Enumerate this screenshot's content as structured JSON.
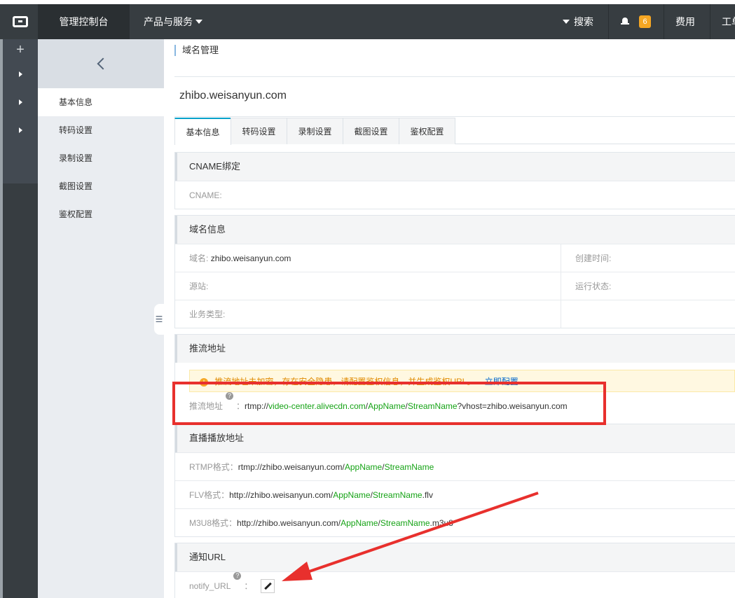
{
  "topbar": {
    "console": "管理控制台",
    "products": "产品与服务",
    "search": "搜索",
    "notifications": "6",
    "fee": "费用",
    "ticket": "工单"
  },
  "rail": {
    "plus": "+"
  },
  "sidebar": {
    "items": [
      {
        "label": "基本信息"
      },
      {
        "label": "转码设置"
      },
      {
        "label": "录制设置"
      },
      {
        "label": "截图设置"
      },
      {
        "label": "鉴权配置"
      }
    ]
  },
  "main": {
    "breadcrumb": "域名管理",
    "domain": "zhibo.weisanyun.com",
    "tabs": [
      {
        "label": "基本信息"
      },
      {
        "label": "转码设置"
      },
      {
        "label": "录制设置"
      },
      {
        "label": "截图设置"
      },
      {
        "label": "鉴权配置"
      }
    ],
    "cname": {
      "title": "CNAME绑定",
      "label": "CNAME:"
    },
    "domain_info": {
      "title": "域名信息",
      "domain_label": "域名:",
      "domain_value": "zhibo.weisanyun.com",
      "created_label": "创建时间:",
      "source_label": "源站:",
      "status_label": "运行状态:",
      "biz_label": "业务类型:"
    },
    "push": {
      "title": "推流地址",
      "alert": "推流地址未加密，存在安全隐患，请配置鉴权信息，并生成鉴权URL。",
      "alert_link": "立即配置",
      "label": "推流地址",
      "p1": "rtmp://",
      "p2": "video-center.alivecdn.com",
      "p3": "/",
      "p4": "AppName",
      "p5": "/",
      "p6": "StreamName",
      "p7": "?vhost=zhibo.weisanyun.com"
    },
    "play": {
      "title": "直播播放地址",
      "rtmp_label": "RTMP格式：",
      "rtmp_prefix": "rtmp://zhibo.weisanyun.com/",
      "flv_label": "FLV格式：",
      "flv_prefix": "http://zhibo.weisanyun.com/",
      "flv_suffix": ".flv",
      "m3u8_label": "M3U8格式：",
      "m3u8_prefix": "http://zhibo.weisanyun.com/",
      "m3u8_suffix": ".m3u8",
      "app": "AppName",
      "slash": "/",
      "stream": "StreamName"
    },
    "notify": {
      "title": "通知URL",
      "label": "notify_URL",
      "colon": "："
    }
  },
  "colors": {
    "accent": "#00a2ca",
    "green": "#16a316",
    "annotation": "#e8302d"
  }
}
